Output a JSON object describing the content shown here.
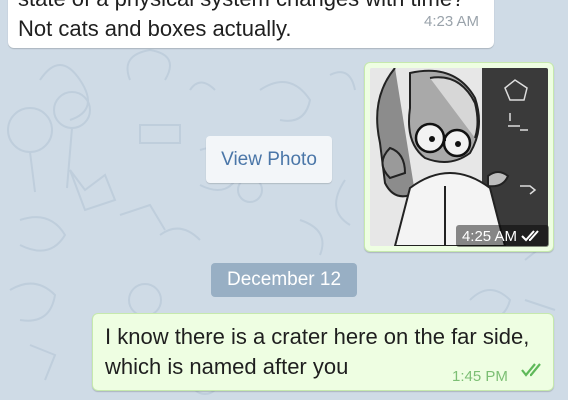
{
  "messages": {
    "incoming": {
      "text": "state of a physical system changes with time? Not cats and boxes actually.",
      "time": "4:23 AM"
    },
    "photo": {
      "time": "4:25 AM",
      "status_icon": "double-check-icon",
      "view_label": "View Photo"
    },
    "outgoing": {
      "text": "I know there is a crater here on the far side, which is named after you",
      "time": "1:45 PM",
      "status_icon": "double-check-icon"
    }
  },
  "date_separator": "December 12",
  "colors": {
    "background": "#cfdbe6",
    "incoming_bubble": "#ffffff",
    "outgoing_bubble": "#eefee2",
    "link": "#4a76a8",
    "read_ticks": "#5fb95a"
  }
}
